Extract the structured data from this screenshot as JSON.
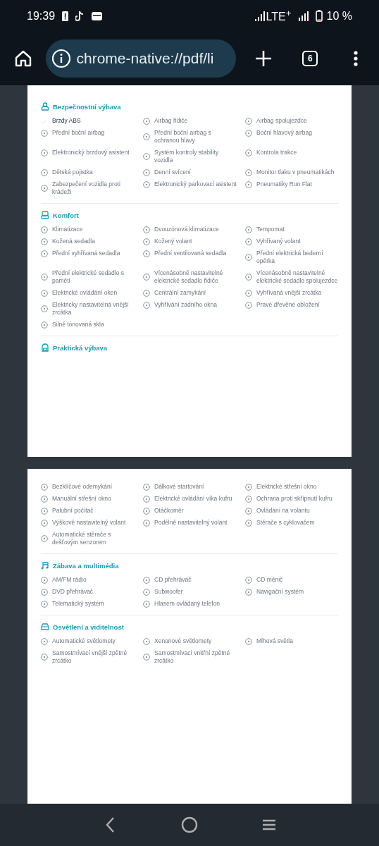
{
  "status_bar": {
    "time": "19:39",
    "network": "LTE$^{+}$",
    "battery": "10 %"
  },
  "toolbar": {
    "url": "chrome-native://pdf/li",
    "tab_count": "6"
  },
  "pages": [
    {
      "sections": [
        {
          "title": "Bezpečnostní výbava",
          "items": [
            {
              "label": "Brzdy ABS",
              "highlighted": true
            },
            {
              "label": "Airbag řidiče",
              "highlighted": false
            },
            {
              "label": "Airbag spolujezdce",
              "highlighted": false
            },
            {
              "label": "Přední boční airbag",
              "highlighted": false
            },
            {
              "label": "Přední boční airbag s ochranou hlavy",
              "highlighted": false
            },
            {
              "label": "Boční hlavový airbag",
              "highlighted": false
            },
            {
              "label": "Elektronický brzdový asistent",
              "highlighted": false
            },
            {
              "label": "Systém kontroly stability vozidla",
              "highlighted": false
            },
            {
              "label": "Kontrola trakce",
              "highlighted": false
            },
            {
              "label": "Dětská pojistka",
              "highlighted": false
            },
            {
              "label": "Denní svícení",
              "highlighted": false
            },
            {
              "label": "Monitor tlaku v pneumatikách",
              "highlighted": false
            },
            {
              "label": "Zabezpečení vozidla proti krádeži",
              "highlighted": false
            },
            {
              "label": "Elektronický parkovací asistent",
              "highlighted": false
            },
            {
              "label": "Pneumatiky Run Flat",
              "highlighted": false
            }
          ]
        },
        {
          "title": "Komfort",
          "items": [
            {
              "label": "Klimatizace",
              "highlighted": false
            },
            {
              "label": "Dvouzónová klimatizace",
              "highlighted": false
            },
            {
              "label": "Tempomat",
              "highlighted": false
            },
            {
              "label": "Kožená sedadla",
              "highlighted": false
            },
            {
              "label": "Kožený volant",
              "highlighted": false
            },
            {
              "label": "Vyhřívaný volant",
              "highlighted": false
            },
            {
              "label": "Přední vyhřívaná sedadla",
              "highlighted": false
            },
            {
              "label": "Přední ventilovaná sedadla",
              "highlighted": false
            },
            {
              "label": "Přední elektrická bederní opěrka",
              "highlighted": false
            },
            {
              "label": "Přední elektrické sedadlo s pamětí",
              "highlighted": false
            },
            {
              "label": "Vícenásobně nastavitelné elektrické sedadlo řidiče",
              "highlighted": false
            },
            {
              "label": "Vícenásobně nastavitelné elektrické sedadlo spolujezdce",
              "highlighted": false
            },
            {
              "label": "Elektrické ovládání oken",
              "highlighted": false
            },
            {
              "label": "Centrální zamykání",
              "highlighted": false
            },
            {
              "label": "Vyhřívaná vnější zrcátka",
              "highlighted": false
            },
            {
              "label": "Elektricky nastavitelná vnější zrcátka",
              "highlighted": false
            },
            {
              "label": "Vyhřívání zadního okna",
              "highlighted": false
            },
            {
              "label": "Pravé dřevěné obložení",
              "highlighted": false
            },
            {
              "label": "Silně tónovaná skla",
              "highlighted": false
            }
          ]
        },
        {
          "title": "Praktická výbava"
        }
      ]
    },
    {
      "sections": [
        {
          "items": [
            {
              "label": "Bezklíčové odemykání",
              "highlighted": false
            },
            {
              "label": "Dálkové startování",
              "highlighted": false
            },
            {
              "label": "Elektrické střešní okno",
              "highlighted": false
            },
            {
              "label": "Manuální střešní okno",
              "highlighted": false
            },
            {
              "label": "Elektrické ovládání víka kufru",
              "highlighted": false
            },
            {
              "label": "Ochrana proti skřípnutí kufru",
              "highlighted": false
            },
            {
              "label": "Palubní počítač",
              "highlighted": false
            },
            {
              "label": "Otáčkoměr",
              "highlighted": false
            },
            {
              "label": "Ovládání na volantu",
              "highlighted": false
            },
            {
              "label": "Výškově nastavitelný volant",
              "highlighted": false
            },
            {
              "label": "Podélně nastavitelný volant",
              "highlighted": false
            },
            {
              "label": "Stěrače s cyklovačem",
              "highlighted": false
            },
            {
              "label": "Automatické stěrače s dešťovým senzorem",
              "highlighted": false
            }
          ]
        },
        {
          "title": "Zábava a multimédia",
          "items": [
            {
              "label": "AM/FM rádio",
              "highlighted": false
            },
            {
              "label": "CD přehrávač",
              "highlighted": false
            },
            {
              "label": "CD měnič",
              "highlighted": false
            },
            {
              "label": "DVD přehrávač",
              "highlighted": false
            },
            {
              "label": "Subwoofer",
              "highlighted": false
            },
            {
              "label": "Navigační systém",
              "highlighted": false
            },
            {
              "label": "Telematický systém",
              "highlighted": false
            },
            {
              "label": "Hlasem ovládaný telefon",
              "highlighted": false
            }
          ]
        },
        {
          "title": "Osvětlení a viditelnost",
          "items": [
            {
              "label": "Automatické světlomety",
              "highlighted": false
            },
            {
              "label": "Xenonové světlomety",
              "highlighted": false
            },
            {
              "label": "Mlhová světla",
              "highlighted": false
            },
            {
              "label": "Samostmívací vnější zpětné zrcátko",
              "highlighted": false
            },
            {
              "label": "Samostmívací vnitřní zpětné zrcátko",
              "highlighted": false
            }
          ]
        }
      ]
    }
  ]
}
